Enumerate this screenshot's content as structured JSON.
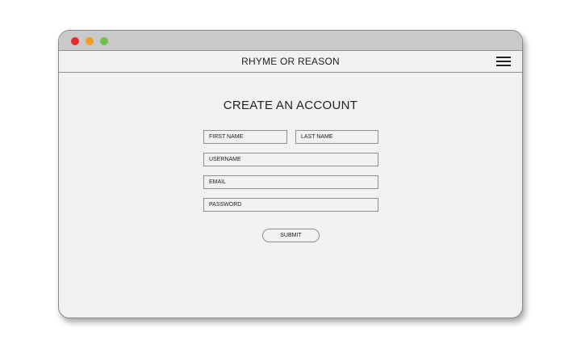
{
  "window": {
    "traffic_lights": {
      "close_color": "#ea2a2a",
      "minimize_color": "#f59a23",
      "zoom_color": "#6cc24a"
    }
  },
  "navbar": {
    "site_title": "RHYME OR REASON",
    "menu_icon": "hamburger-menu-icon"
  },
  "form": {
    "heading": "CREATE AN ACCOUNT",
    "first_name": {
      "placeholder": "FIRST NAME",
      "value": ""
    },
    "last_name": {
      "placeholder": "LAST NAME",
      "value": ""
    },
    "username": {
      "placeholder": "USERNAME",
      "value": ""
    },
    "email": {
      "placeholder": "EMAIL",
      "value": ""
    },
    "password": {
      "placeholder": "PASSWORD",
      "value": ""
    },
    "submit_label": "SUBMIT"
  }
}
